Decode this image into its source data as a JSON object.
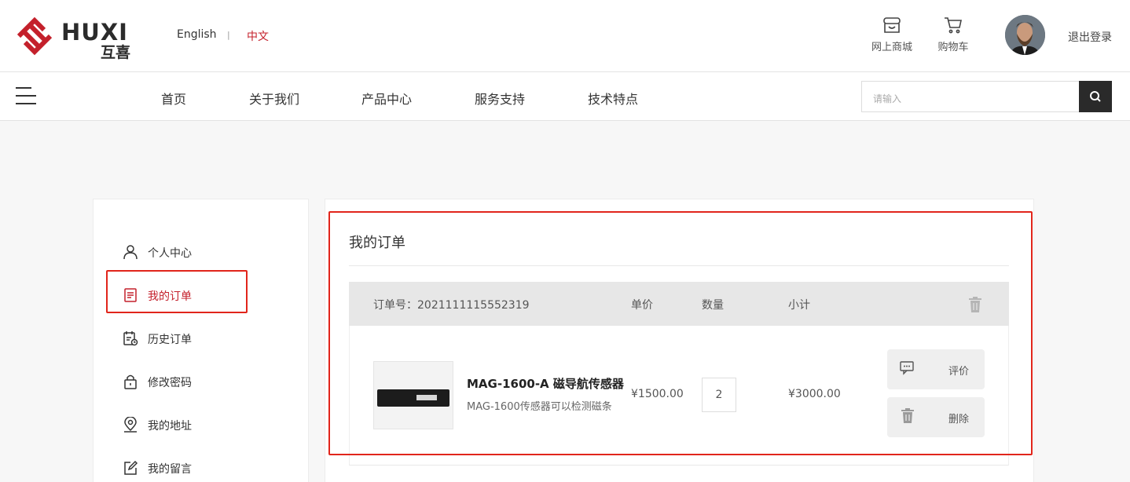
{
  "header": {
    "logo_text": "HUXI",
    "logo_sub": "互喜",
    "lang_en": "English",
    "lang_sep": "|",
    "lang_zh": "中文",
    "shop_label": "网上商城",
    "cart_label": "购物车",
    "logout_label": "退出登录",
    "brand_color": "#c4202b"
  },
  "nav": {
    "items": [
      "首页",
      "关于我们",
      "产品中心",
      "服务支持",
      "技术特点"
    ],
    "search_placeholder": "请输入"
  },
  "sidebar": {
    "items": [
      {
        "label": "个人中心",
        "icon": "user-icon"
      },
      {
        "label": "我的订单",
        "icon": "order-icon"
      },
      {
        "label": "历史订单",
        "icon": "history-icon"
      },
      {
        "label": "修改密码",
        "icon": "lock-icon"
      },
      {
        "label": "我的地址",
        "icon": "location-icon"
      },
      {
        "label": "我的留言",
        "icon": "edit-icon"
      }
    ],
    "active": "我的订单"
  },
  "orders": {
    "title": "我的订单",
    "header": {
      "order_no": "订单号：2021111115552319",
      "unit_price": "单价",
      "quantity": "数量",
      "subtotal": "小计"
    },
    "rows": [
      {
        "name": "MAG-1600-A 磁导航传感器",
        "desc": "MAG-1600传感器可以检测磁条",
        "price": "¥1500.00",
        "qty": "2",
        "subtotal": "¥3000.00",
        "review_label": "评价",
        "delete_label": "删除"
      }
    ]
  }
}
